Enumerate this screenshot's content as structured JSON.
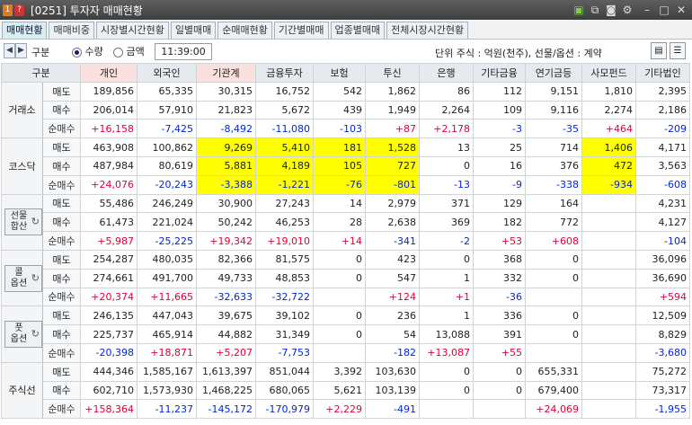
{
  "window": {
    "title": "[0251] 투자자 매매현황"
  },
  "tabs": [
    "매매현황",
    "매매비중",
    "시장별시간현황",
    "일별매매",
    "순매매현황",
    "기간별매매",
    "업종별매매",
    "전체시장시간현황"
  ],
  "toolbar": {
    "gubun": "구분",
    "opt_qty": "수량",
    "opt_amt": "금액",
    "time": "11:39:00",
    "unit": "단위 주식 : 억원(천주), 선물/옵션 : 계약"
  },
  "columns": [
    "구분",
    "개인",
    "외국인",
    "기관계",
    "금융투자",
    "보험",
    "투신",
    "은행",
    "기타금융",
    "연기금등",
    "사모펀드",
    "기타법인"
  ],
  "groups": [
    {
      "name": "거래소",
      "rows": [
        {
          "label": "매도",
          "v": [
            "189,856",
            "65,335",
            "30,315",
            "16,752",
            "542",
            "1,862",
            "86",
            "112",
            "9,151",
            "1,810",
            "2,395"
          ]
        },
        {
          "label": "매수",
          "v": [
            "206,014",
            "57,910",
            "21,823",
            "5,672",
            "439",
            "1,949",
            "2,264",
            "109",
            "9,116",
            "2,274",
            "2,186"
          ]
        },
        {
          "label": "순매수",
          "v": [
            "+16,158",
            "-7,425",
            "-8,492",
            "-11,080",
            "-103",
            "+87",
            "+2,178",
            "-3",
            "-35",
            "+464",
            "-209"
          ]
        }
      ]
    },
    {
      "name": "코스닥",
      "rows": [
        {
          "label": "매도",
          "v": [
            "463,908",
            "100,862",
            "9,269",
            "5,410",
            "181",
            "1,528",
            "13",
            "25",
            "714",
            "1,406",
            "4,171"
          ]
        },
        {
          "label": "매수",
          "v": [
            "487,984",
            "80,619",
            "5,881",
            "4,189",
            "105",
            "727",
            "0",
            "16",
            "376",
            "472",
            "3,563"
          ]
        },
        {
          "label": "순매수",
          "v": [
            "+24,076",
            "-20,243",
            "-3,388",
            "-1,221",
            "-76",
            "-801",
            "-13",
            "-9",
            "-338",
            "-934",
            "-608"
          ]
        }
      ]
    },
    {
      "name": "선물\n합산",
      "btn": true,
      "rows": [
        {
          "label": "매도",
          "v": [
            "55,486",
            "246,249",
            "30,900",
            "27,243",
            "14",
            "2,979",
            "371",
            "129",
            "164",
            "",
            "4,231"
          ]
        },
        {
          "label": "매수",
          "v": [
            "61,473",
            "221,024",
            "50,242",
            "46,253",
            "28",
            "2,638",
            "369",
            "182",
            "772",
            "",
            "4,127"
          ]
        },
        {
          "label": "순매수",
          "v": [
            "+5,987",
            "-25,225",
            "+19,342",
            "+19,010",
            "+14",
            "-341",
            "-2",
            "+53",
            "+608",
            "",
            "-104"
          ]
        }
      ]
    },
    {
      "name": "콜\n옵션",
      "btn": true,
      "rows": [
        {
          "label": "매도",
          "v": [
            "254,287",
            "480,035",
            "82,366",
            "81,575",
            "0",
            "423",
            "0",
            "368",
            "0",
            "",
            "36,096"
          ]
        },
        {
          "label": "매수",
          "v": [
            "274,661",
            "491,700",
            "49,733",
            "48,853",
            "0",
            "547",
            "1",
            "332",
            "0",
            "",
            "36,690"
          ]
        },
        {
          "label": "순매수",
          "v": [
            "+20,374",
            "+11,665",
            "-32,633",
            "-32,722",
            "",
            "+124",
            "+1",
            "-36",
            "",
            "",
            "+594"
          ]
        }
      ]
    },
    {
      "name": "풋\n옵션",
      "btn": true,
      "rows": [
        {
          "label": "매도",
          "v": [
            "246,135",
            "447,043",
            "39,675",
            "39,102",
            "0",
            "236",
            "1",
            "336",
            "0",
            "",
            "12,509"
          ]
        },
        {
          "label": "매수",
          "v": [
            "225,737",
            "465,914",
            "44,882",
            "31,349",
            "0",
            "54",
            "13,088",
            "391",
            "0",
            "",
            "8,829"
          ]
        },
        {
          "label": "순매수",
          "v": [
            "-20,398",
            "+18,871",
            "+5,207",
            "-7,753",
            "",
            "-182",
            "+13,087",
            "+55",
            "",
            "",
            "-3,680"
          ]
        }
      ]
    },
    {
      "name": "주식선",
      "rows": [
        {
          "label": "매도",
          "v": [
            "444,346",
            "1,585,167",
            "1,613,397",
            "851,044",
            "3,392",
            "103,630",
            "0",
            "0",
            "655,331",
            "",
            "75,272"
          ]
        },
        {
          "label": "매수",
          "v": [
            "602,710",
            "1,573,930",
            "1,468,225",
            "680,065",
            "5,621",
            "103,139",
            "0",
            "0",
            "679,400",
            "",
            "73,317"
          ]
        },
        {
          "label": "순매수",
          "v": [
            "+158,364",
            "-11,237",
            "-145,172",
            "-170,979",
            "+2,229",
            "-491",
            "",
            "",
            "+24,069",
            "",
            "-1,955"
          ]
        }
      ]
    }
  ],
  "highlight": {
    "group": 1,
    "cols": [
      2,
      3,
      4,
      5,
      9
    ]
  }
}
